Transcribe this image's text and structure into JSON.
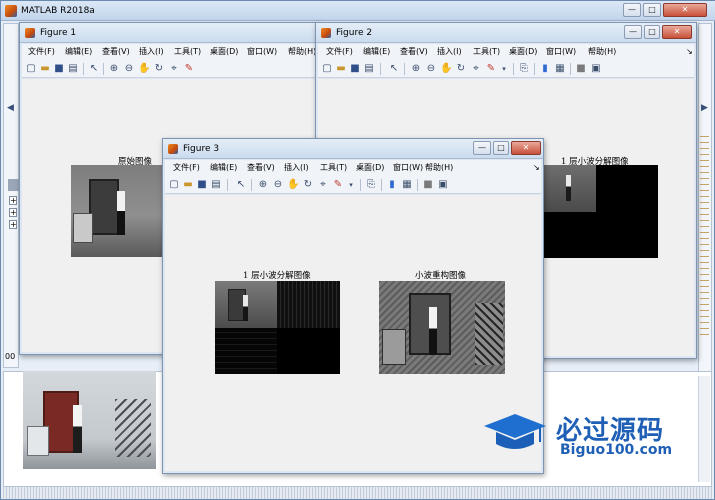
{
  "matlab": {
    "title": "MATLAB R2018a",
    "side_marks": [
      "+",
      "+",
      "+"
    ],
    "bottom_label": "00",
    "min_btn": "—",
    "max_btn": "□",
    "close_btn": "✕"
  },
  "menu": [
    "文件(F)",
    "编辑(E)",
    "查看(V)",
    "插入(I)",
    "工具(T)",
    "桌面(D)",
    "窗口(W)",
    "帮助(H)"
  ],
  "figures": {
    "fig1": {
      "title": "Figure 1",
      "axes_title": "原始图像"
    },
    "fig2": {
      "title": "Figure 2",
      "axes_title": "1 层小波分解图像"
    },
    "fig3": {
      "title": "Figure 3",
      "axes_left_title": "1 层小波分解图像",
      "axes_right_title": "小波重构图像"
    }
  },
  "watermark": {
    "brand": "必过源码",
    "url": "Biguo100.com"
  },
  "icons": [
    "new-file-icon",
    "open-folder-icon",
    "save-icon",
    "print-icon",
    "arrow-pointer-icon",
    "zoom-in-icon",
    "zoom-out-icon",
    "pan-hand-icon",
    "rotate-3d-icon",
    "data-cursor-icon",
    "brush-icon",
    "link-plot-icon",
    "colorbar-icon",
    "legend-icon",
    "hide-plot-tools-icon",
    "show-plot-tools-icon"
  ]
}
